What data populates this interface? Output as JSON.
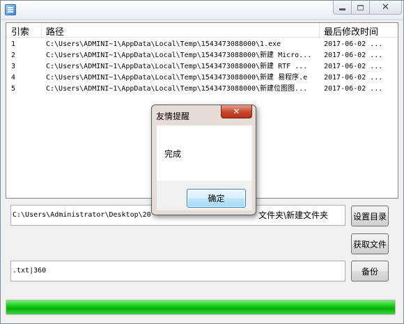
{
  "window": {
    "controls": {
      "close": "✕"
    }
  },
  "list": {
    "columns": [
      "引索",
      "路径",
      "最后修改时间"
    ],
    "rows": [
      {
        "index": "1",
        "path": "C:\\Users\\ADMINI~1\\AppData\\Local\\Temp\\1543473088000\\1.exe",
        "modified": "2017-06-02 ..."
      },
      {
        "index": "2",
        "path": "C:\\Users\\ADMINI~1\\AppData\\Local\\Temp\\1543473088000\\新建 Micro...",
        "modified": "2017-06-02 ..."
      },
      {
        "index": "3",
        "path": "C:\\Users\\ADMINI~1\\AppData\\Local\\Temp\\1543473088000\\新建 RTF ...",
        "modified": "2017-06-02 ..."
      },
      {
        "index": "4",
        "path": "C:\\Users\\ADMINI~1\\AppData\\Local\\Temp\\1543473088000\\新建 易程序.e",
        "modified": "2017-06-02 ..."
      },
      {
        "index": "5",
        "path": "C:\\Users\\ADMINI~1\\AppData\\Local\\Temp\\1543473088000\\新建位图图...",
        "modified": "2017-06-02 ..."
      }
    ]
  },
  "form": {
    "path_value": "C:\\Users\\Administrator\\Desktop\\20",
    "path_value_tail": "文件夹\\新建文件夹",
    "ext_value": ".txt|360",
    "set_dir_label": "设置目录",
    "get_files_label": "获取文件",
    "backup_label": "备份"
  },
  "progress": {
    "percent": 100,
    "color": "#06b006"
  },
  "dialog": {
    "title": "友情提醒",
    "close": "✕",
    "message": "完成",
    "ok_label": "确定"
  }
}
